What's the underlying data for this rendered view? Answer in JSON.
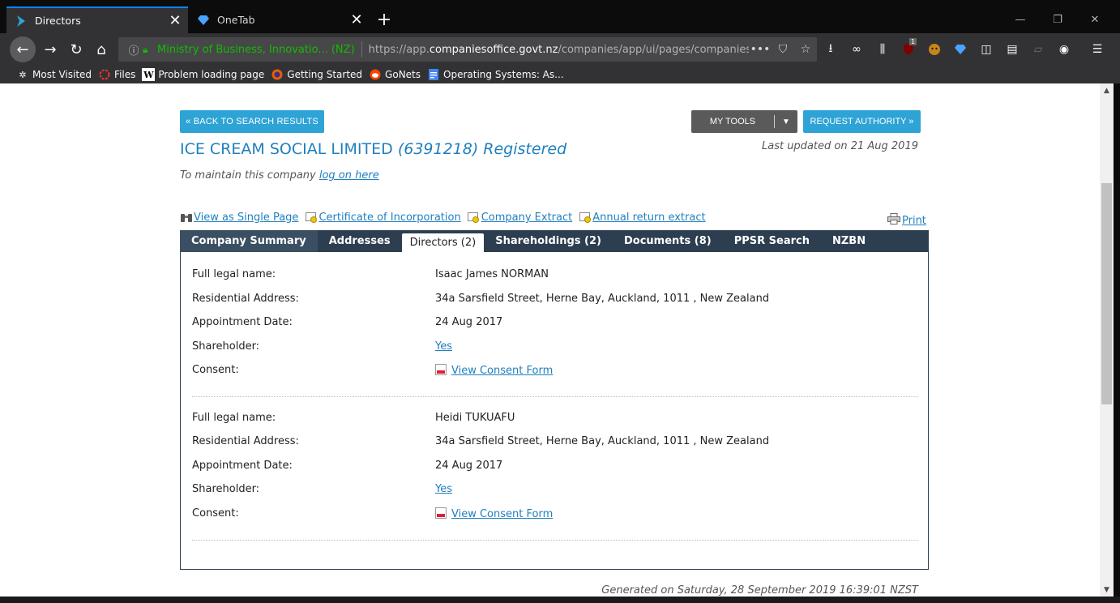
{
  "browser": {
    "tabs": [
      {
        "title": "Directors",
        "active": true
      },
      {
        "title": "OneTab",
        "active": false
      }
    ],
    "identity": "Ministry of Business, Innovatio... (NZ)",
    "url_prefix": "https://app.",
    "url_domain": "companiesoffice.govt.nz",
    "url_path": "/companies/app/ui/pages/companies/",
    "badge_count": "1",
    "bookmarks": [
      {
        "label": "Most Visited",
        "icon": "gear-icon"
      },
      {
        "label": "Files",
        "icon": "ring-icon"
      },
      {
        "label": "Problem loading page",
        "icon": "wikipedia-icon"
      },
      {
        "label": "Getting Started",
        "icon": "firefox-icon"
      },
      {
        "label": "GoNets",
        "icon": "reddit-icon"
      },
      {
        "label": "Operating Systems: As...",
        "icon": "document-icon"
      }
    ]
  },
  "page": {
    "back_button": "« BACK TO SEARCH RESULTS",
    "my_tools_button": "MY TOOLS",
    "request_authority_button": "REQUEST AUTHORITY »",
    "company_name": "ICE CREAM SOCIAL LIMITED",
    "company_number_status": "(6391218) Registered",
    "last_updated": "Last updated on 21 Aug 2019",
    "maintain_text": "To maintain this company",
    "maintain_link": "log on here",
    "links": [
      {
        "label": "View as Single Page",
        "icon": "binoculars-icon"
      },
      {
        "label": "Certificate of Incorporation",
        "icon": "certificate-icon"
      },
      {
        "label": "Company Extract",
        "icon": "certificate-icon"
      },
      {
        "label": "Annual return extract",
        "icon": "certificate-icon"
      }
    ],
    "print_label": "Print",
    "tabs": [
      {
        "label": "Company Summary"
      },
      {
        "label": "Addresses"
      },
      {
        "label": "Directors (2)",
        "selected": true
      },
      {
        "label": "Shareholdings (2)"
      },
      {
        "label": "Documents (8)"
      },
      {
        "label": "PPSR Search"
      },
      {
        "label": "NZBN"
      }
    ],
    "field_labels": {
      "name": "Full legal name:",
      "address": "Residential Address:",
      "appointment": "Appointment Date:",
      "shareholder": "Shareholder:",
      "consent": "Consent:"
    },
    "directors": [
      {
        "name": "Isaac James NORMAN",
        "address": "34a Sarsfield Street, Herne Bay, Auckland, 1011 , New Zealand",
        "appointment": "24 Aug 2017",
        "shareholder": "Yes",
        "consent": "View Consent Form"
      },
      {
        "name": "Heidi TUKUAFU",
        "address": "34a Sarsfield Street, Herne Bay, Auckland, 1011 , New Zealand",
        "appointment": "24 Aug 2017",
        "shareholder": "Yes",
        "consent": "View Consent Form"
      }
    ],
    "generated": "Generated on Saturday, 28 September 2019 16:39:01 NZST"
  },
  "colors": {
    "link": "#1f7fbf",
    "button_blue": "#2ea3d6",
    "tab_bar": "#2d3e50",
    "secure_green": "#12bc00"
  }
}
